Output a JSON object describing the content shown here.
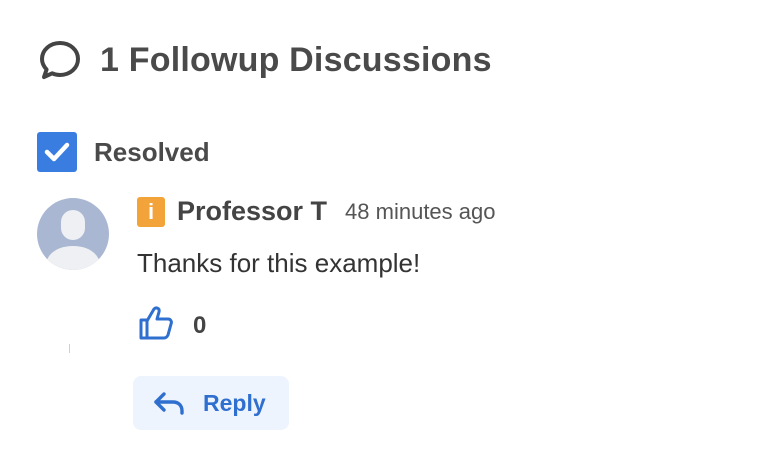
{
  "header": {
    "title": "1 Followup Discussions",
    "icon": "speech-bubble-icon"
  },
  "resolved": {
    "label": "Resolved",
    "checked": true,
    "accent": "#3a7de0"
  },
  "followup": {
    "role_badge": "i",
    "role_color": "#f2a43a",
    "author": "Professor T",
    "timestamp": "48 minutes ago",
    "message": "Thanks for this example!",
    "like_count": "0",
    "reply_label": "Reply"
  }
}
